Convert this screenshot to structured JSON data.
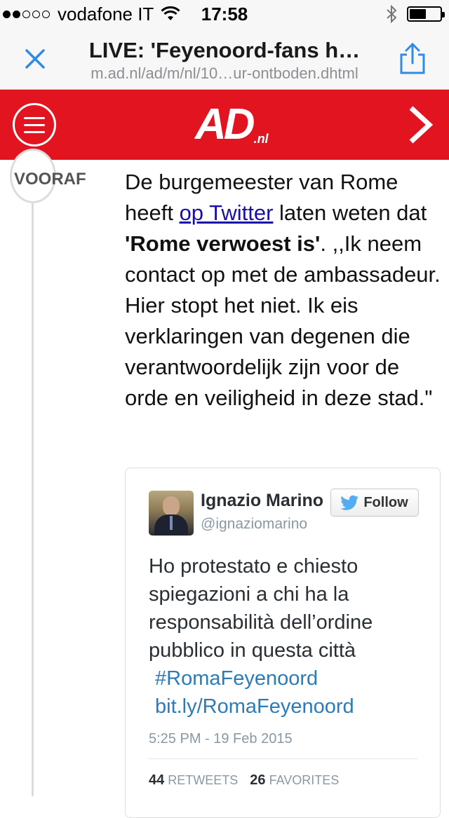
{
  "status_bar": {
    "carrier": "vodafone IT",
    "time": "17:58",
    "signal_bars_filled": 2,
    "signal_bars_total": 5,
    "battery_level": 0.55
  },
  "browser": {
    "title": "LIVE: 'Feyenoord-fans h…",
    "url": "m.ad.nl/ad/m/nl/10…ur-ontboden.dhtml",
    "close_icon": "close-icon",
    "share_icon": "share-icon"
  },
  "site_header": {
    "logo": "AD",
    "logo_suffix": ".nl",
    "brand_color": "#e1141f",
    "menu_icon": "hamburger-menu-icon",
    "next_icon": "chevron-right-icon"
  },
  "timeline": {
    "label": "VOORAF"
  },
  "article": {
    "part1": "De burgemeester van Rome heeft ",
    "link": "op Twitter",
    "part2": " laten weten dat ",
    "bold": "'Rome verwoest is'",
    "part3": ". ,,Ik neem contact op met de ambassadeur. Hier stopt het niet. Ik eis verklaringen van degenen die verantwoordelijk zijn voor de orde en veiligheid in deze stad.\""
  },
  "tweet": {
    "name": "Ignazio Marino",
    "handle": "@ignaziomarino",
    "follow_label": "Follow",
    "text": "Ho protestato e chiesto spiegazioni a chi ha la responsabilità dell’ordine pubblico in questa città",
    "hashtag": "#RomaFeyenoord",
    "link": "bit.ly/RomaFeyenoord",
    "date": "5:25 PM - 19 Feb 2015",
    "retweets_count": "44",
    "retweets_label": "RETWEETS",
    "favorites_count": "26",
    "favorites_label": "FAVORITES",
    "link_color": "#2b7bb9"
  }
}
